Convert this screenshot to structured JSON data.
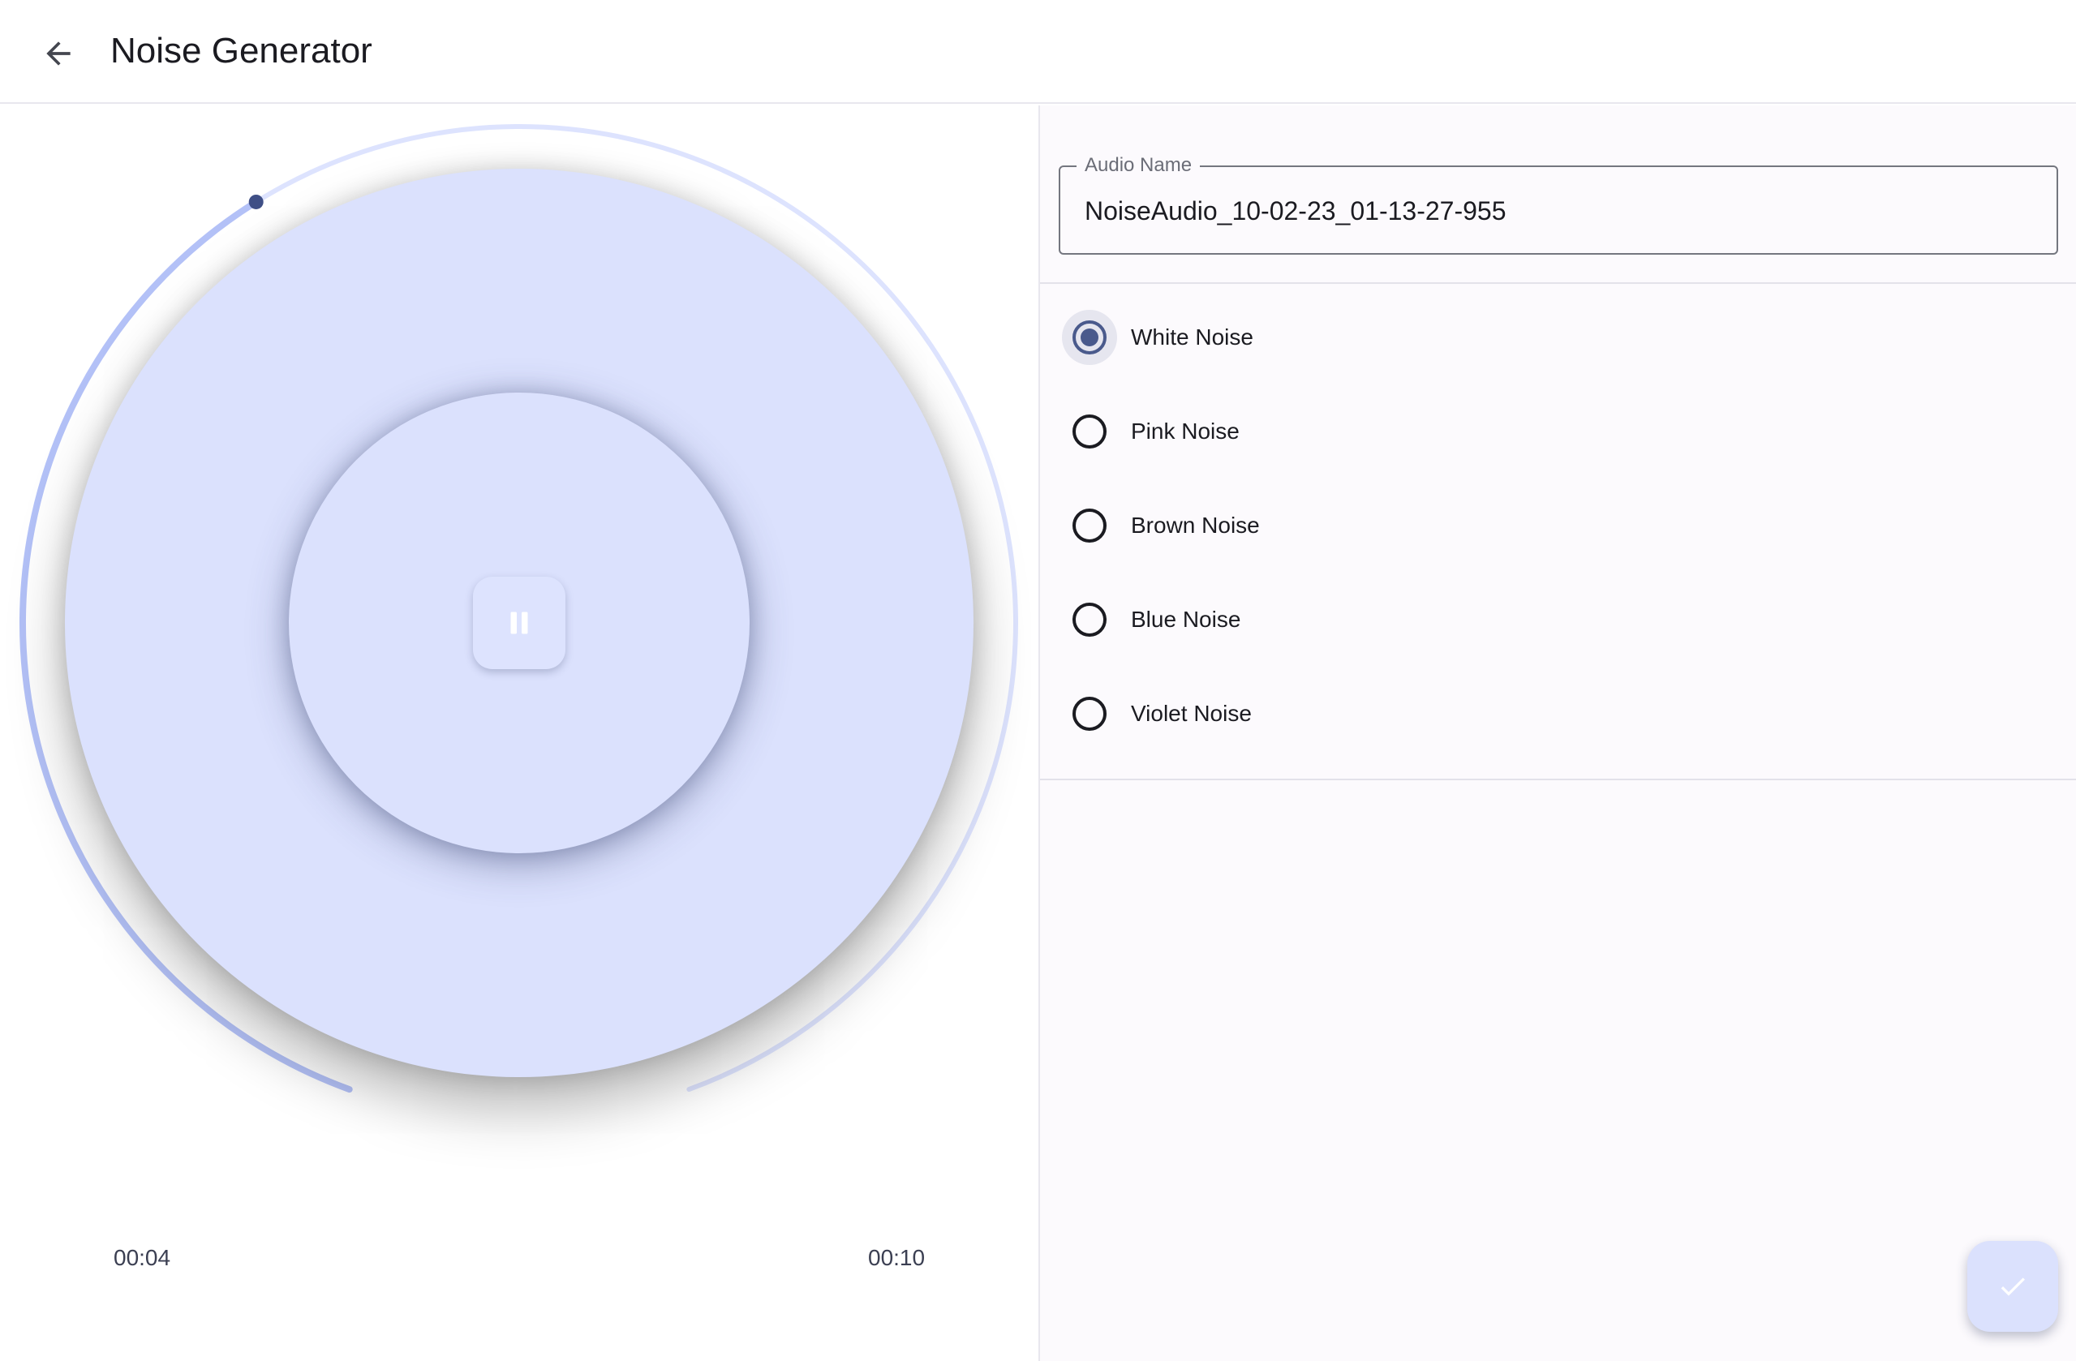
{
  "header": {
    "title": "Noise Generator",
    "back_icon": "arrow-back-icon"
  },
  "player": {
    "elapsed": "00:04",
    "total": "00:10",
    "progress_fraction": 0.4,
    "pause_icon": "pause-icon",
    "colors": {
      "disc": "#dbe1fd",
      "arc_progress": "#b3c1f7",
      "arc_track": "#dde3fe",
      "thumb": "#3f4f86"
    }
  },
  "form": {
    "audio_name_label": "Audio Name",
    "audio_name_value": "NoiseAudio_10-02-23_01-13-27-955"
  },
  "noise_types": [
    {
      "label": "White Noise",
      "selected": true
    },
    {
      "label": "Pink Noise",
      "selected": false
    },
    {
      "label": "Brown Noise",
      "selected": false
    },
    {
      "label": "Blue Noise",
      "selected": false
    },
    {
      "label": "Violet Noise",
      "selected": false
    }
  ],
  "fab": {
    "icon": "check-icon"
  },
  "accent_color": "#4a5a8c"
}
